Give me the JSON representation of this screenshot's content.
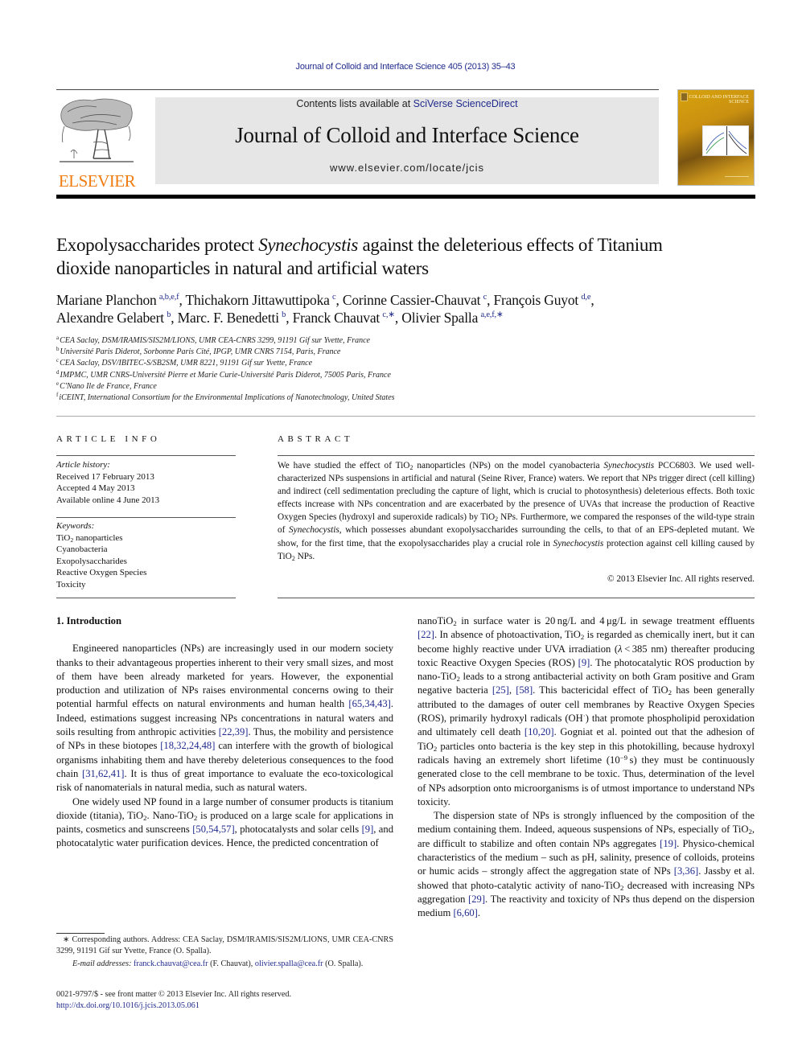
{
  "running_head": "Journal of Colloid and Interface Science 405 (2013) 35–43",
  "masthead": {
    "contents_prefix": "Contents lists available at ",
    "contents_link": "SciVerse ScienceDirect",
    "journal_name": "Journal of Colloid and Interface Science",
    "url": "www.elsevier.com/locate/jcis",
    "publisher_logo_text": "ELSEVIER",
    "publisher_color": "#f07c12",
    "cover_title": "COLLOID AND INTERFACE SCIENCE"
  },
  "article": {
    "title_part1": "Exopolysaccharides protect ",
    "title_italic": "Synechocystis",
    "title_part2": " against the deleterious effects of Titanium dioxide nanoparticles in natural and artificial waters",
    "authors": [
      {
        "name": "Mariane Planchon",
        "sup": "a,b,e,f",
        "sep": ", "
      },
      {
        "name": "Thichakorn Jittawuttipoka",
        "sup": "c",
        "sep": ", "
      },
      {
        "name": "Corinne Cassier-Chauvat",
        "sup": "c",
        "sep": ", "
      },
      {
        "name": "François Guyot",
        "sup": "d,e",
        "sep": ","
      },
      {
        "name": "Alexandre Gelabert",
        "sup": "b",
        "sep": ", "
      },
      {
        "name": "Marc. F. Benedetti",
        "sup": "b",
        "sep": ", "
      },
      {
        "name": "Franck Chauvat",
        "sup": "c,∗",
        "sep": ", "
      },
      {
        "name": "Olivier Spalla",
        "sup": "a,e,f,∗",
        "sep": ""
      }
    ],
    "affiliations": [
      {
        "key": "a",
        "text": "CEA Saclay, DSM/IRAMIS/SIS2M/LIONS, UMR CEA-CNRS 3299, 91191 Gif sur Yvette, France"
      },
      {
        "key": "b",
        "text": "Université Paris Diderot, Sorbonne Paris Cité, IPGP, UMR CNRS 7154, Paris, France"
      },
      {
        "key": "c",
        "text": "CEA Saclay, DSV/IBITEC-S/SB2SM, UMR 8221, 91191 Gif sur Yvette, France"
      },
      {
        "key": "d",
        "text": "IMPMC, UMR CNRS-Université Pierre et Marie Curie-Université Paris Diderot, 75005 Paris, France"
      },
      {
        "key": "e",
        "text": "C'Nano Ile de France, France"
      },
      {
        "key": "f",
        "text": "iCEINT, International Consortium for the Environmental Implications of Nanotechnology, United States"
      }
    ]
  },
  "article_info": {
    "heading": "ARTICLE INFO",
    "history_label": "Article history:",
    "received": "Received 17 February 2013",
    "accepted": "Accepted 4 May 2013",
    "online": "Available online 4 June 2013",
    "keywords_label": "Keywords:",
    "keywords": [
      "TiO2 nanoparticles",
      "Cyanobacteria",
      "Exopolysaccharides",
      "Reactive Oxygen Species",
      "Toxicity"
    ]
  },
  "abstract": {
    "heading": "ABSTRACT",
    "copyright": "© 2013 Elsevier Inc. All rights reserved."
  },
  "body": {
    "section_heading": "1. Introduction"
  },
  "footnotes": {
    "corresponding": "∗ Corresponding authors. Address: CEA Saclay, DSM/IRAMIS/SIS2M/LIONS, UMR CEA-CNRS 3299, 91191 Gif sur Yvette, France (O. Spalla).",
    "email_label": "E-mail addresses:",
    "email1": "franck.chauvat@cea.fr",
    "email1_owner": " (F. Chauvat), ",
    "email2": "olivier.spalla@cea.fr",
    "email2_owner": " (O. Spalla).",
    "front_matter": "0021-9797/$ - see front matter © 2013 Elsevier Inc. All rights reserved.",
    "doi": "http://dx.doi.org/10.1016/j.jcis.2013.05.061"
  },
  "colors": {
    "link": "#1f2a8c",
    "masthead_bg": "#e6e6e6"
  }
}
